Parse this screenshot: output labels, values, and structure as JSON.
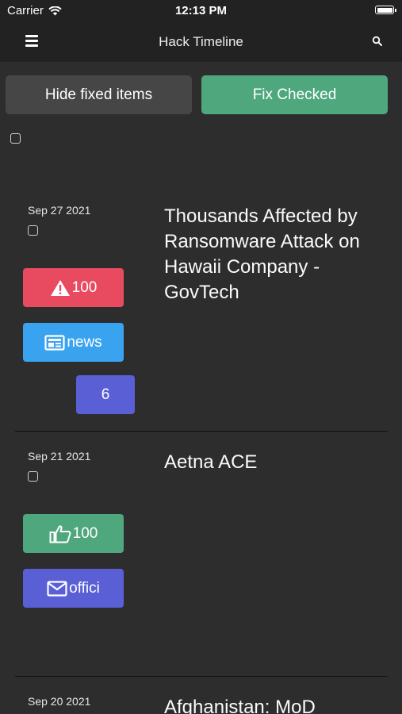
{
  "status_bar": {
    "carrier": "Carrier",
    "time": "12:13 PM"
  },
  "nav": {
    "title": "Hack Timeline"
  },
  "buttons": {
    "hide_fixed": "Hide fixed items",
    "fix_checked": "Fix Checked"
  },
  "colors": {
    "background": "#2d2d2d",
    "bar": "#222222",
    "fix_button": "#4fa77e",
    "hide_button": "#464646",
    "badge_red": "#e84a5f",
    "badge_blue": "#3aa3f0",
    "badge_purple": "#5a5fd6",
    "badge_green": "#4fa77e"
  },
  "entries": [
    {
      "date": "Sep 27 2021",
      "headline": "Thousands Affected by Ransomware Attack on Hawaii Company - GovTech",
      "badges": [
        {
          "icon": "warning-icon",
          "label": "100",
          "color": "#e84a5f"
        },
        {
          "icon": "news-icon",
          "label": "news",
          "color": "#3aa3f0"
        },
        {
          "icon": "",
          "label": "6",
          "color": "#5a5fd6"
        }
      ]
    },
    {
      "date": "Sep 21 2021",
      "headline": "Aetna ACE",
      "badges": [
        {
          "icon": "thumbs-up-icon",
          "label": "100",
          "color": "#4fa77e"
        },
        {
          "icon": "mail-icon",
          "label": "offici",
          "color": "#5a5fd6"
        }
      ]
    },
    {
      "date": "Sep 20 2021",
      "headline": "Afghanistan: MoD"
    }
  ]
}
